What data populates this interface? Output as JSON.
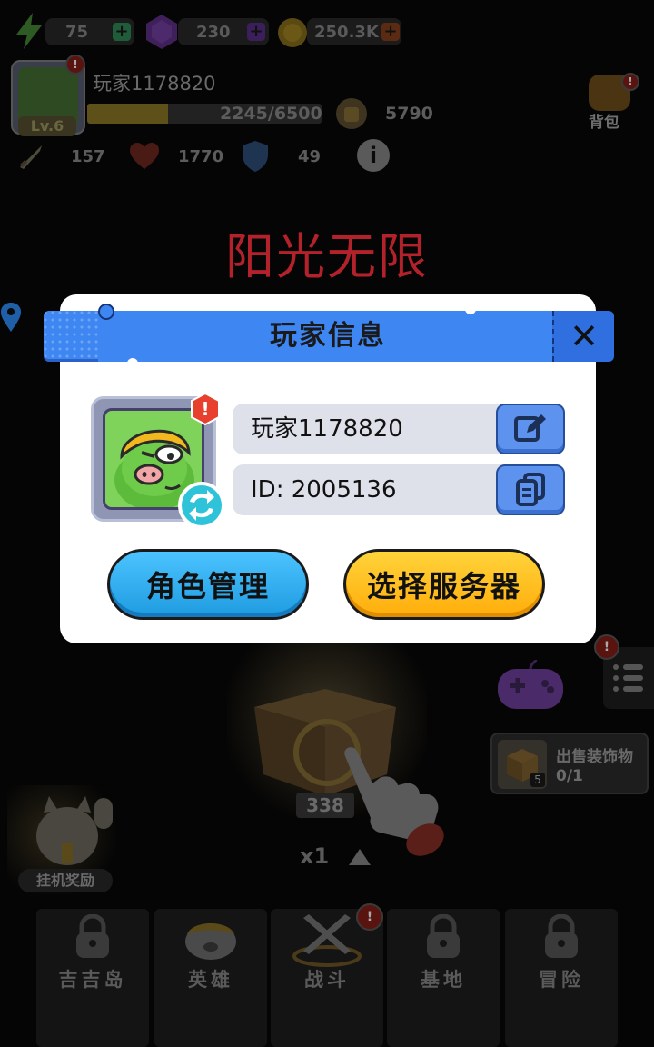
{
  "topbar": {
    "energy": "75",
    "gems": "230",
    "coins": "250.3K"
  },
  "player": {
    "name": "玩家1178820",
    "level": "Lv.6",
    "exp": "2245/6500",
    "exp_fraction": 0.345,
    "power": "5790"
  },
  "stats": {
    "attack": "157",
    "hp": "1770",
    "defense": "49"
  },
  "backpack_label": "背包",
  "server_banner": "阳光无限",
  "badge_mark": "!",
  "dialog": {
    "title": "玩家信息",
    "close": "✕",
    "name_value": "玩家1178820",
    "id_value": "ID: 2005136",
    "role_button": "角色管理",
    "server_button": "选择服务器"
  },
  "sell_panel": {
    "title": "出售装饰物",
    "progress": "0/1",
    "item_count": "5"
  },
  "chest": {
    "count": "338",
    "multiplier": "x1"
  },
  "idle_reward_label": "挂机奖励",
  "nav": [
    {
      "label": "吉吉岛"
    },
    {
      "label": "英雄"
    },
    {
      "label": "战斗"
    },
    {
      "label": "基地"
    },
    {
      "label": "冒险"
    }
  ],
  "colors": {
    "dialog_title_bg": "#3e86f2",
    "role_button": "#29a6ee",
    "server_button": "#ffbe1a",
    "banner_red": "#b3222a"
  }
}
